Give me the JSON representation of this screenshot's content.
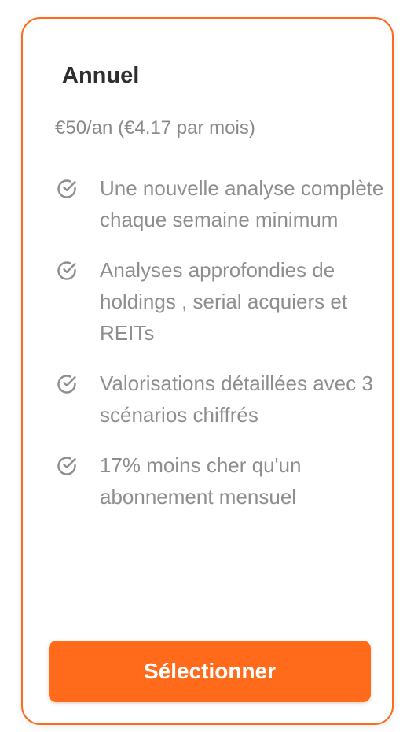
{
  "plan": {
    "title": "Annuel",
    "price": "€50/an (€4.17 par mois)",
    "features": [
      {
        "icon": "circle-check-icon",
        "text": "Une nouvelle analyse complète chaque semaine minimum"
      },
      {
        "icon": "circle-check-icon",
        "text": "Analyses approfondies de holdings , serial acquiers et REITs"
      },
      {
        "icon": "circle-check-icon",
        "text": "Valorisations détaillées avec 3 scénarios chiffrés"
      },
      {
        "icon": "circle-check-icon",
        "text": "17% moins cher qu'un abonnement mensuel"
      }
    ],
    "button_label": "Sélectionner"
  },
  "colors": {
    "accent": "#ff6b1a",
    "title": "#2f2f2f",
    "muted_text": "#8e8e8e",
    "background": "#ffffff"
  }
}
